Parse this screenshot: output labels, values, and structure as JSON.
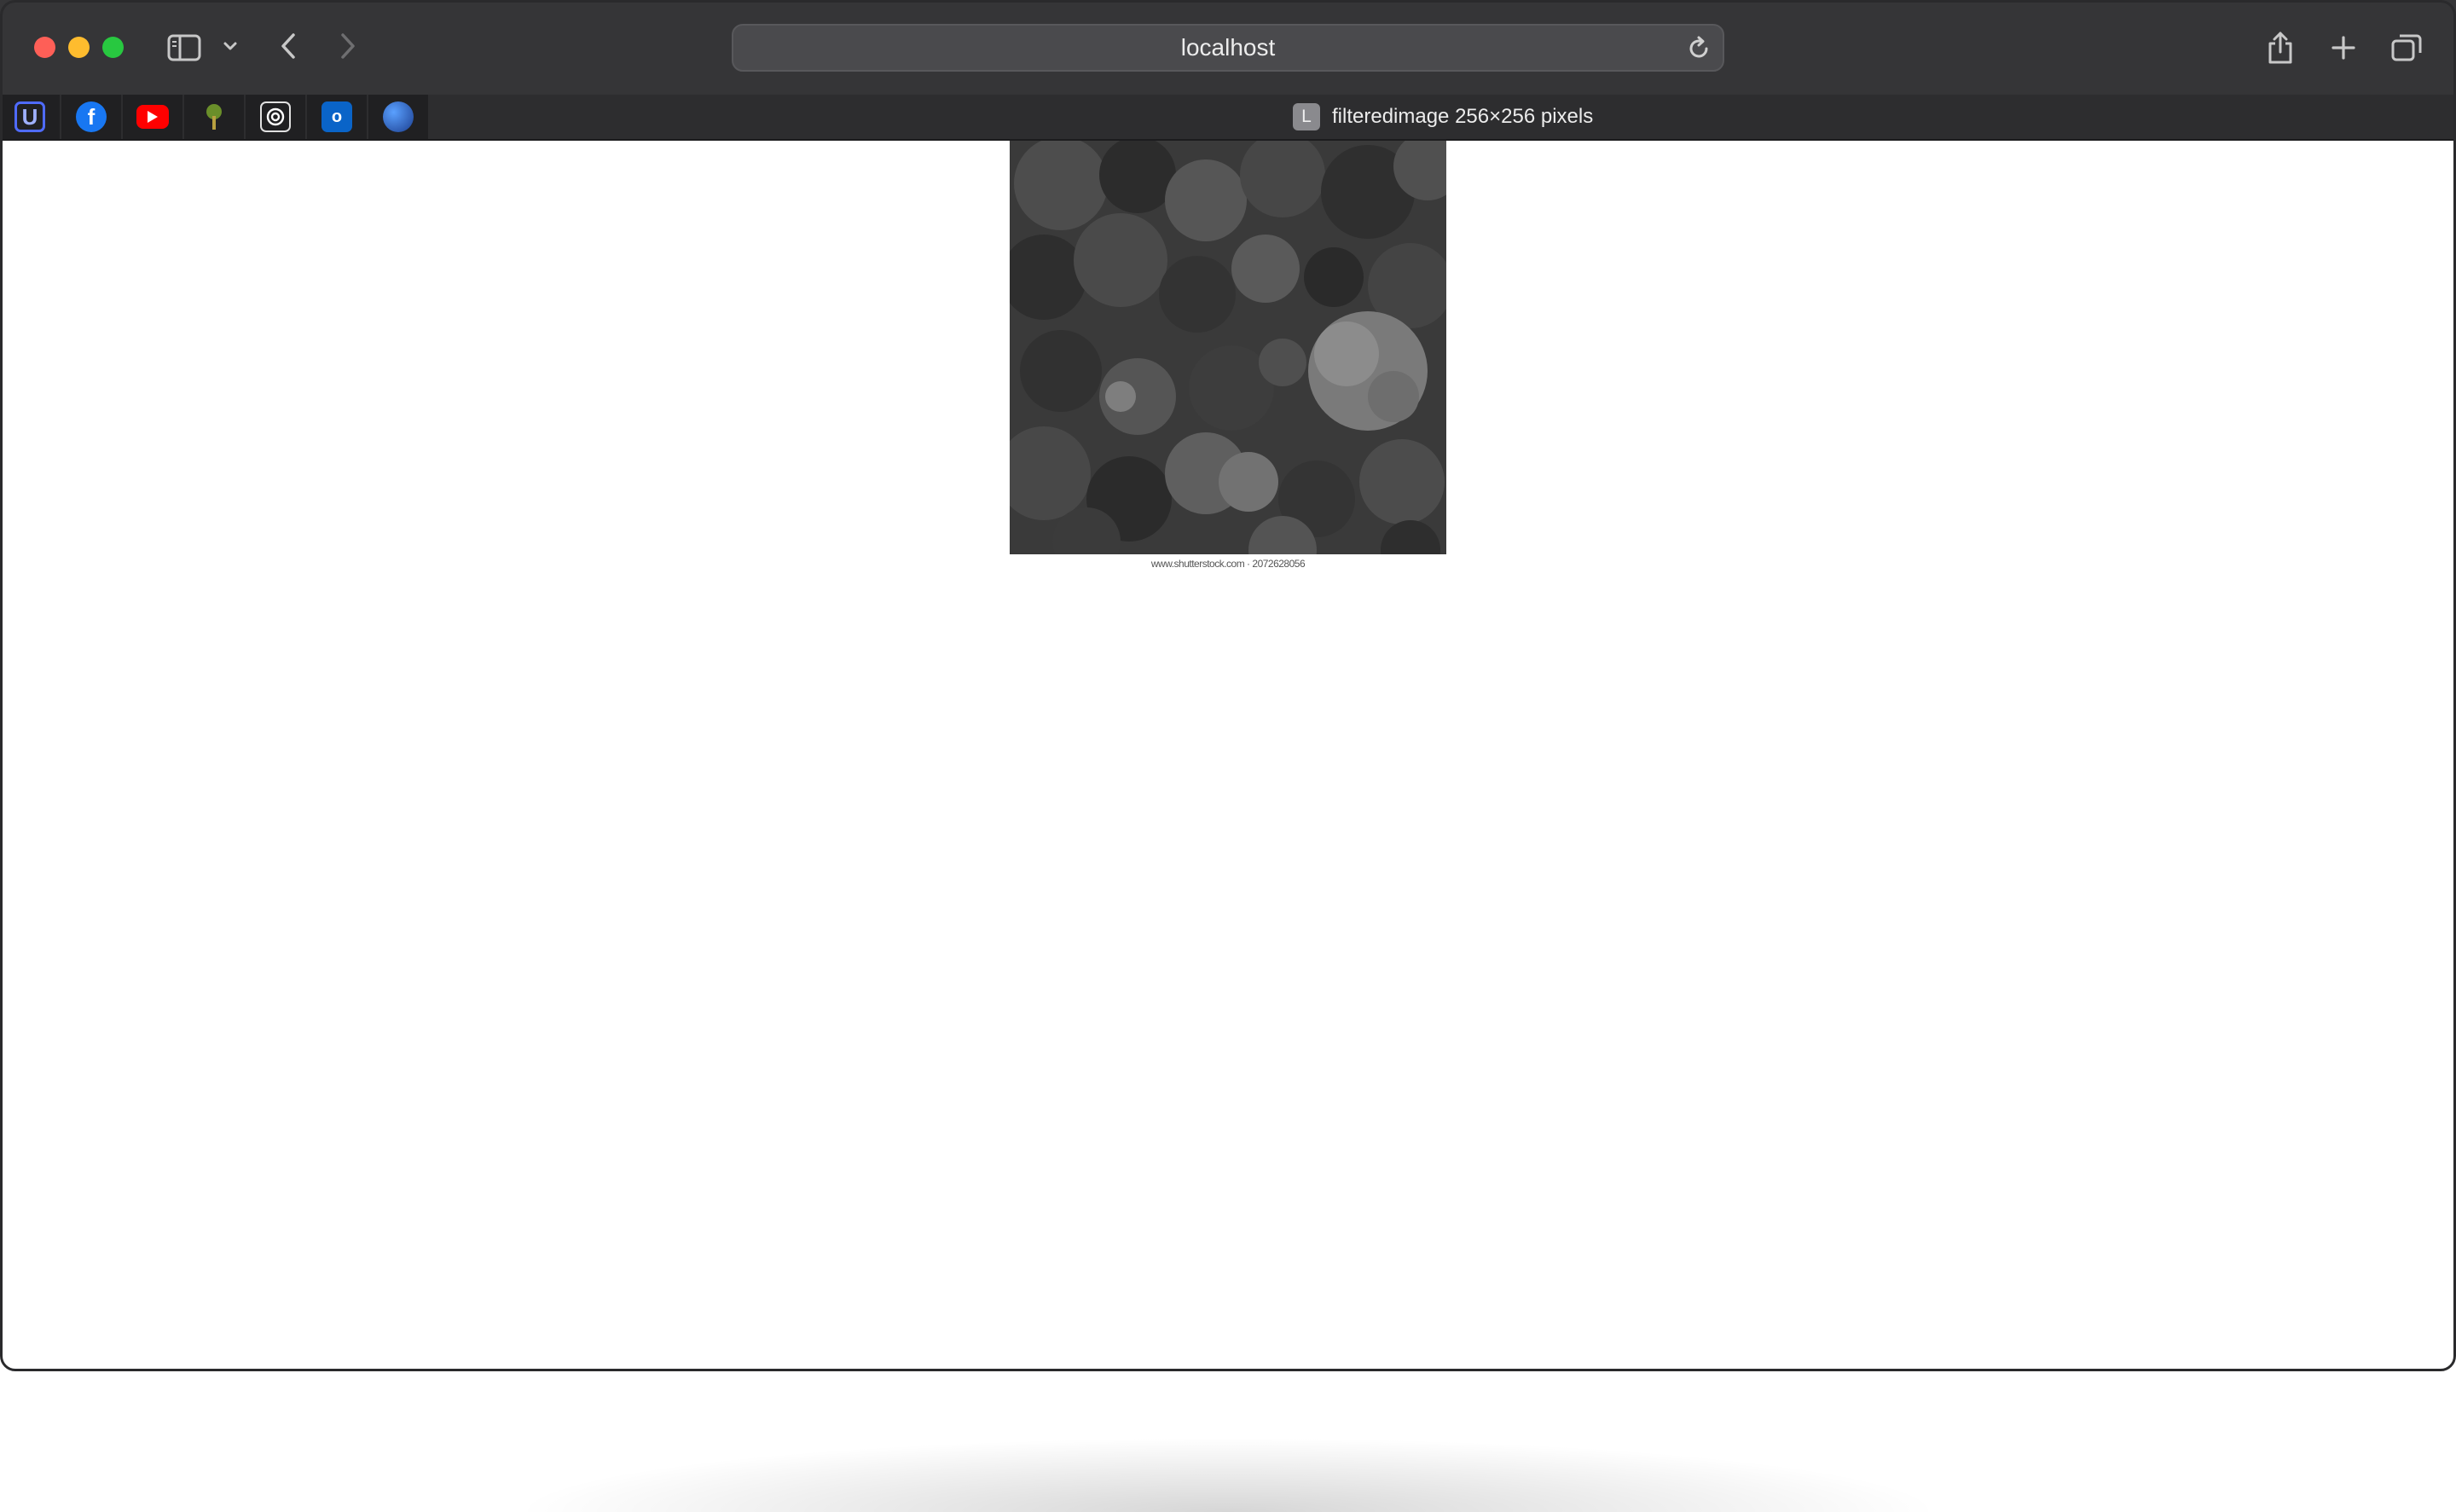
{
  "browser": {
    "address": "localhost",
    "tab": {
      "favicon_letter": "L",
      "title": "filteredimage 256×256 pixels"
    },
    "favorites": [
      {
        "name": "site-u",
        "icon": "letter-u-icon",
        "color": "#4f6bff"
      },
      {
        "name": "facebook",
        "icon": "facebook-icon",
        "color": "#1877f2"
      },
      {
        "name": "youtube",
        "icon": "youtube-icon",
        "color": "#ff0000"
      },
      {
        "name": "tree",
        "icon": "tree-icon",
        "color": "#6a8f2a"
      },
      {
        "name": "openai",
        "icon": "openai-icon",
        "color": "#ffffff"
      },
      {
        "name": "outlook",
        "icon": "outlook-icon",
        "color": "#0a64c8"
      },
      {
        "name": "sphere",
        "icon": "sphere-icon",
        "color": "#2a6fd6"
      }
    ]
  },
  "content": {
    "image_caption": "www.shutterstock.com · 2072628056"
  },
  "colors": {
    "toolbar": "#353537",
    "address_bar": "#4a4a4d",
    "page_background": "#ffffff"
  }
}
